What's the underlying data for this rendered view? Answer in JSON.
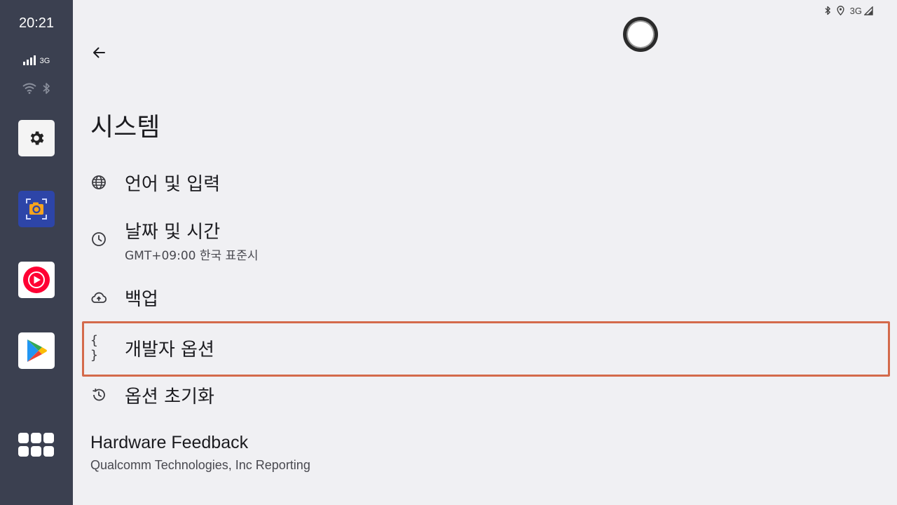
{
  "rail": {
    "clock": "20:21",
    "network_type": "3G",
    "apps": [
      "settings-icon",
      "screenshot-camera-icon",
      "youtube-music-icon",
      "play-store-icon",
      "app-grid-icon"
    ]
  },
  "statusbar": {
    "network_type": "3G",
    "icons": [
      "bluetooth-icon",
      "location-icon",
      "signal-icon"
    ]
  },
  "header": {
    "back_icon": "arrow-left-icon",
    "title": "시스템"
  },
  "items": [
    {
      "title": "언어 및 입력",
      "icon": "globe-icon"
    },
    {
      "title": "날짜 및 시간",
      "summary": "GMT+09:00 한국 표준시",
      "icon": "clock-icon"
    },
    {
      "title": "백업",
      "icon": "cloud-upload-icon"
    },
    {
      "title": "개발자 옵션",
      "icon": "braces-icon",
      "icon_text": "{ }",
      "highlighted": true
    },
    {
      "title": "옵션 초기화",
      "icon": "history-icon"
    },
    {
      "title": "Hardware Feedback",
      "summary": "Qualcomm Technologies, Inc Reporting"
    }
  ],
  "colors": {
    "rail_background": "#3b4050",
    "page_background": "#f0f0f3",
    "highlight_border": "#d46a4b"
  }
}
